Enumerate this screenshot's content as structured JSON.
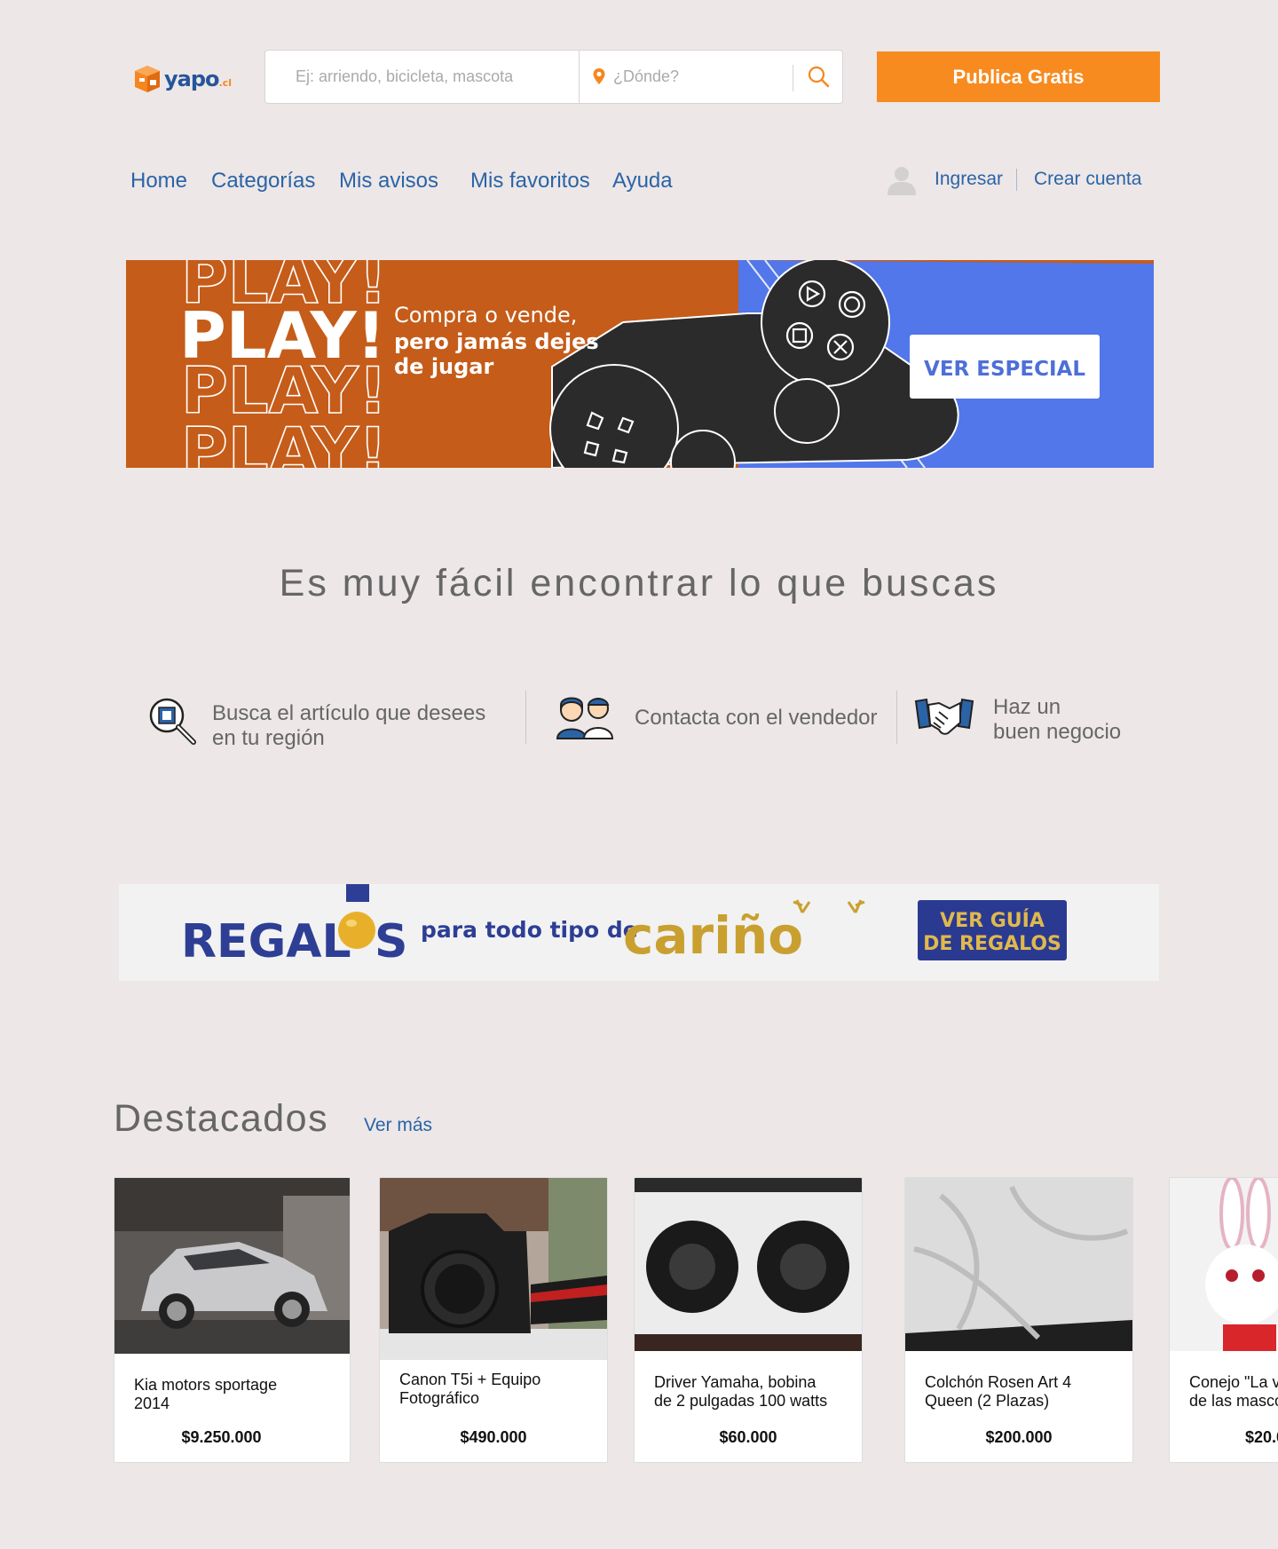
{
  "header": {
    "logo_text": "yapo",
    "logo_suffix": ".cl",
    "search_placeholder": "Ej: arriendo, bicicleta, mascota",
    "location_placeholder": "¿Dónde?",
    "publish_label": "Publica Gratis"
  },
  "nav": {
    "items": [
      "Home",
      "Categorías",
      "Mis avisos",
      "Mis favoritos",
      "Ayuda"
    ],
    "login": "Ingresar",
    "register": "Crear cuenta"
  },
  "play_banner": {
    "outline_word": "PLAY!",
    "headline": "PLAY!",
    "line1": "Compra o vende,",
    "line2": "pero jamás dejes",
    "line3": "de jugar",
    "cta": "VER ESPECIAL"
  },
  "tagline": "Es muy fácil encontrar lo que buscas",
  "steps": [
    {
      "line1": "Busca el artículo que desees",
      "line2": "en tu región",
      "icon": "magnifier-icon"
    },
    {
      "line1": "Contacta con el vendedor",
      "line2": "",
      "icon": "people-contact-icon"
    },
    {
      "line1": "Haz un",
      "line2": "buen negocio",
      "icon": "handshake-icon"
    }
  ],
  "regalos_banner": {
    "word_regalos": "REGAL",
    "word_s": "S",
    "middle": "para todo tipo de",
    "word_carino": "cariño",
    "cta_line1": "VER GUÍA",
    "cta_line2": "DE REGALOS"
  },
  "destacados": {
    "title": "Destacados",
    "see_more": "Ver más",
    "items": [
      {
        "title_l1": "Kia motors sportage",
        "title_l2": "2014",
        "price": "$9.250.000"
      },
      {
        "title_l1": "Canon T5i + Equipo",
        "title_l2": "Fotográfico",
        "price": "$490.000"
      },
      {
        "title_l1": "Driver Yamaha, bobina",
        "title_l2": "de 2 pulgadas 100 watts",
        "price": "$60.000"
      },
      {
        "title_l1": "Colchón Rosen Art 4",
        "title_l2": "Queen (2 Plazas)",
        "price": "$200.000"
      },
      {
        "title_l1": "Conejo \"La v",
        "title_l2": "de las masco",
        "price": "$20.0"
      }
    ]
  },
  "colors": {
    "background": "#ede7e7",
    "brand_orange": "#f78b1f",
    "link_blue": "#2a64a7",
    "banner_orange": "#c55c19",
    "banner_blue": "#5277ea"
  }
}
